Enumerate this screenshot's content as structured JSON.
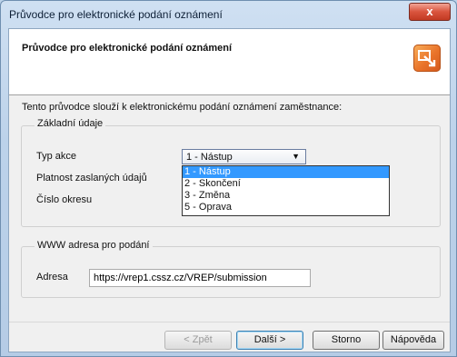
{
  "window": {
    "title": "Průvodce pro elektronické podání oznámení",
    "close_label": "x"
  },
  "header": {
    "title": "Průvodce pro elektronické podání oznámení",
    "icon": "wizard-icon"
  },
  "intro_text": "Tento průvodce slouží k elektronickému podání oznámení zaměstnance:",
  "basic_group": {
    "label": "Základní údaje",
    "action_type_label": "Typ akce",
    "action_type_value": "1 - Nástup",
    "validity_label": "Platnost zaslaných údajů",
    "district_label": "Číslo okresu",
    "dropdown_options": [
      "1 - Nástup",
      "2 - Skončení",
      "3 - Změna",
      "5 - Oprava"
    ]
  },
  "www_group": {
    "label": "WWW adresa pro podání",
    "address_label": "Adresa",
    "address_value": "https://vrep1.cssz.cz/VREP/submission"
  },
  "buttons": {
    "back": "< Zpět",
    "next": "Další >",
    "cancel": "Storno",
    "help": "Nápověda"
  }
}
